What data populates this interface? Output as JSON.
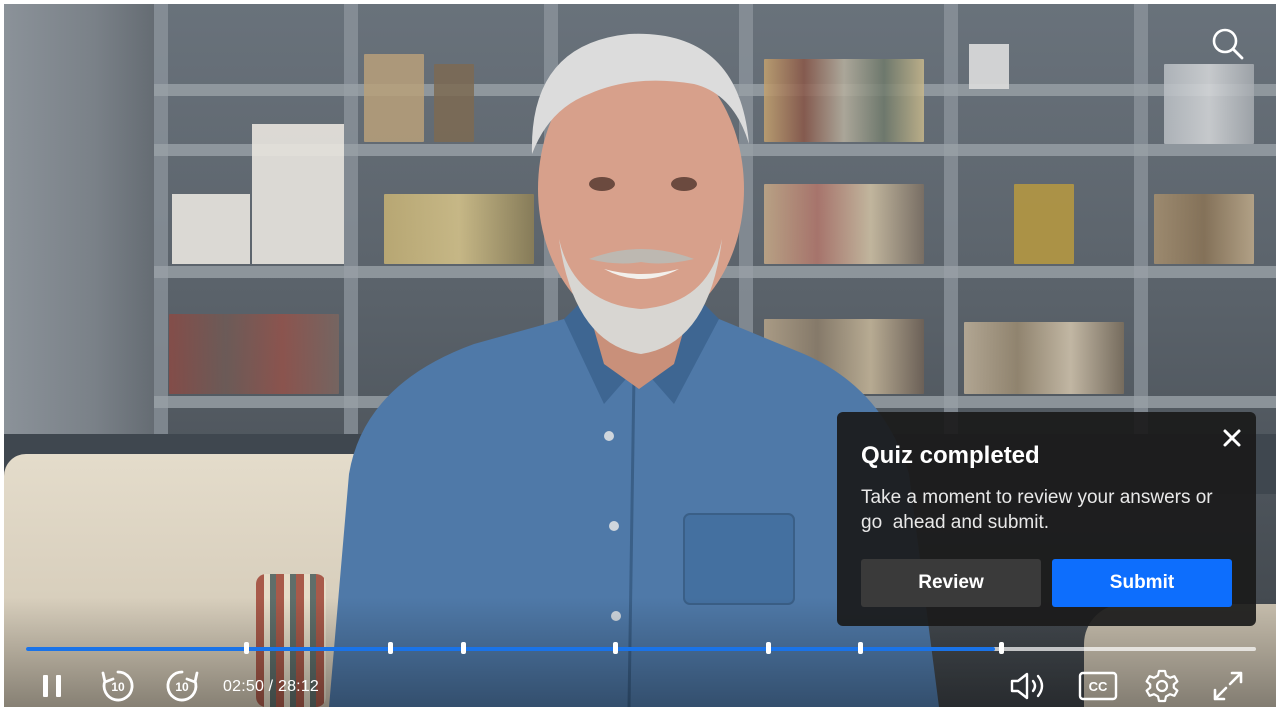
{
  "player": {
    "time_display": "02:50 / 28:12",
    "progress_fraction": 0.788,
    "chapter_markers": [
      0.179,
      0.296,
      0.355,
      0.479,
      0.603,
      0.678,
      0.793
    ],
    "accent_color": "#1a73e8"
  },
  "controls": {
    "search_icon": "search-icon",
    "pause_icon": "pause-icon",
    "rewind": {
      "icon": "rewind-10-icon",
      "label": "10"
    },
    "forward": {
      "icon": "forward-10-icon",
      "label": "10"
    },
    "volume_icon": "volume-icon",
    "captions": {
      "icon": "closed-captions-icon",
      "label": "CC"
    },
    "settings_icon": "gear-icon",
    "fullscreen_icon": "exit-fullscreen-icon"
  },
  "quiz_popup": {
    "title": "Quiz completed",
    "message": "Take a moment to review your answers or go  ahead and submit.",
    "close_icon": "close-icon",
    "review_label": "Review",
    "submit_label": "Submit",
    "submit_color": "#0d6efd"
  }
}
